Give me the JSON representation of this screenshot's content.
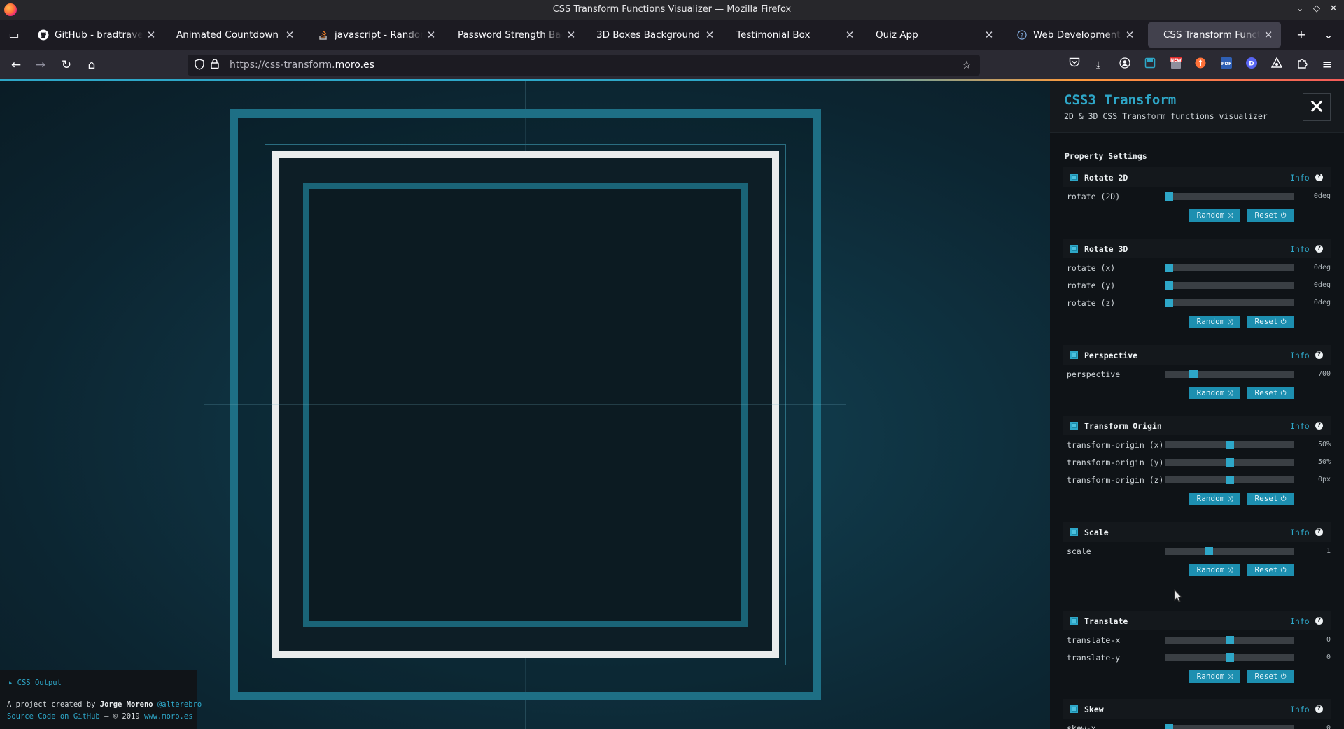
{
  "window": {
    "title": "CSS Transform Functions Visualizer — Mozilla Firefox"
  },
  "tabs": [
    {
      "label": "GitHub - bradtraversy/",
      "icon": "github-icon"
    },
    {
      "label": "Animated Countdown",
      "icon": ""
    },
    {
      "label": "javascript - Random co",
      "icon": "stackoverflow-icon"
    },
    {
      "label": "Password Strength Backgro",
      "icon": ""
    },
    {
      "label": "3D Boxes Background",
      "icon": ""
    },
    {
      "label": "Testimonial Box",
      "icon": ""
    },
    {
      "label": "Quiz App",
      "icon": ""
    },
    {
      "label": "Web Development Gui",
      "icon": "info-icon"
    },
    {
      "label": "CSS Transform Functio",
      "icon": "",
      "active": true
    }
  ],
  "nav": {
    "url_prefix": "https://css-transform.",
    "url_domain": "moro.es"
  },
  "colors": {
    "accent": "#2ea7c8",
    "sidebar_bg": "#0f1317",
    "stage_bg": "#0f3443",
    "box_border": "#1e6f85",
    "white_border": "#e9ecec"
  },
  "footer": {
    "css_output": "CSS Output",
    "line1_prefix": "A project created by ",
    "author": "Jorge Moreno",
    "handle": "@alterebro",
    "source_link": "Source Code on GitHub",
    "copyright": " – © 2019 ",
    "site_link": "www.moro.es"
  },
  "sidebar": {
    "title": "CSS3 Transform",
    "subtitle": "2D & 3D CSS Transform functions visualizer",
    "section_title": "Property Settings",
    "info_label": "Info",
    "random_label": "Random",
    "reset_label": "Reset",
    "groups": [
      {
        "title": "Rotate 2D",
        "rows": [
          {
            "label": "rotate (2D)",
            "value": "0deg",
            "position": 0.03
          }
        ]
      },
      {
        "title": "Rotate 3D",
        "rows": [
          {
            "label": "rotate (x)",
            "value": "0deg",
            "position": 0.03
          },
          {
            "label": "rotate (y)",
            "value": "0deg",
            "position": 0.03
          },
          {
            "label": "rotate (z)",
            "value": "0deg",
            "position": 0.03
          }
        ]
      },
      {
        "title": "Perspective",
        "rows": [
          {
            "label": "perspective",
            "value": "700",
            "position": 0.22
          }
        ]
      },
      {
        "title": "Transform Origin",
        "rows": [
          {
            "label": "transform-origin (x)",
            "value": "50%",
            "position": 0.5
          },
          {
            "label": "transform-origin (y)",
            "value": "50%",
            "position": 0.5
          },
          {
            "label": "transform-origin (z)",
            "value": "0px",
            "position": 0.5
          }
        ]
      },
      {
        "title": "Scale",
        "rows": [
          {
            "label": "scale",
            "value": "1",
            "position": 0.34
          }
        ]
      },
      {
        "title": "Translate",
        "rows": [
          {
            "label": "translate-x",
            "value": "0",
            "position": 0.5
          },
          {
            "label": "translate-y",
            "value": "0",
            "position": 0.5
          }
        ]
      },
      {
        "title": "Skew",
        "rows": [
          {
            "label": "skew-x",
            "value": "0",
            "position": 0.03
          }
        ]
      }
    ]
  }
}
